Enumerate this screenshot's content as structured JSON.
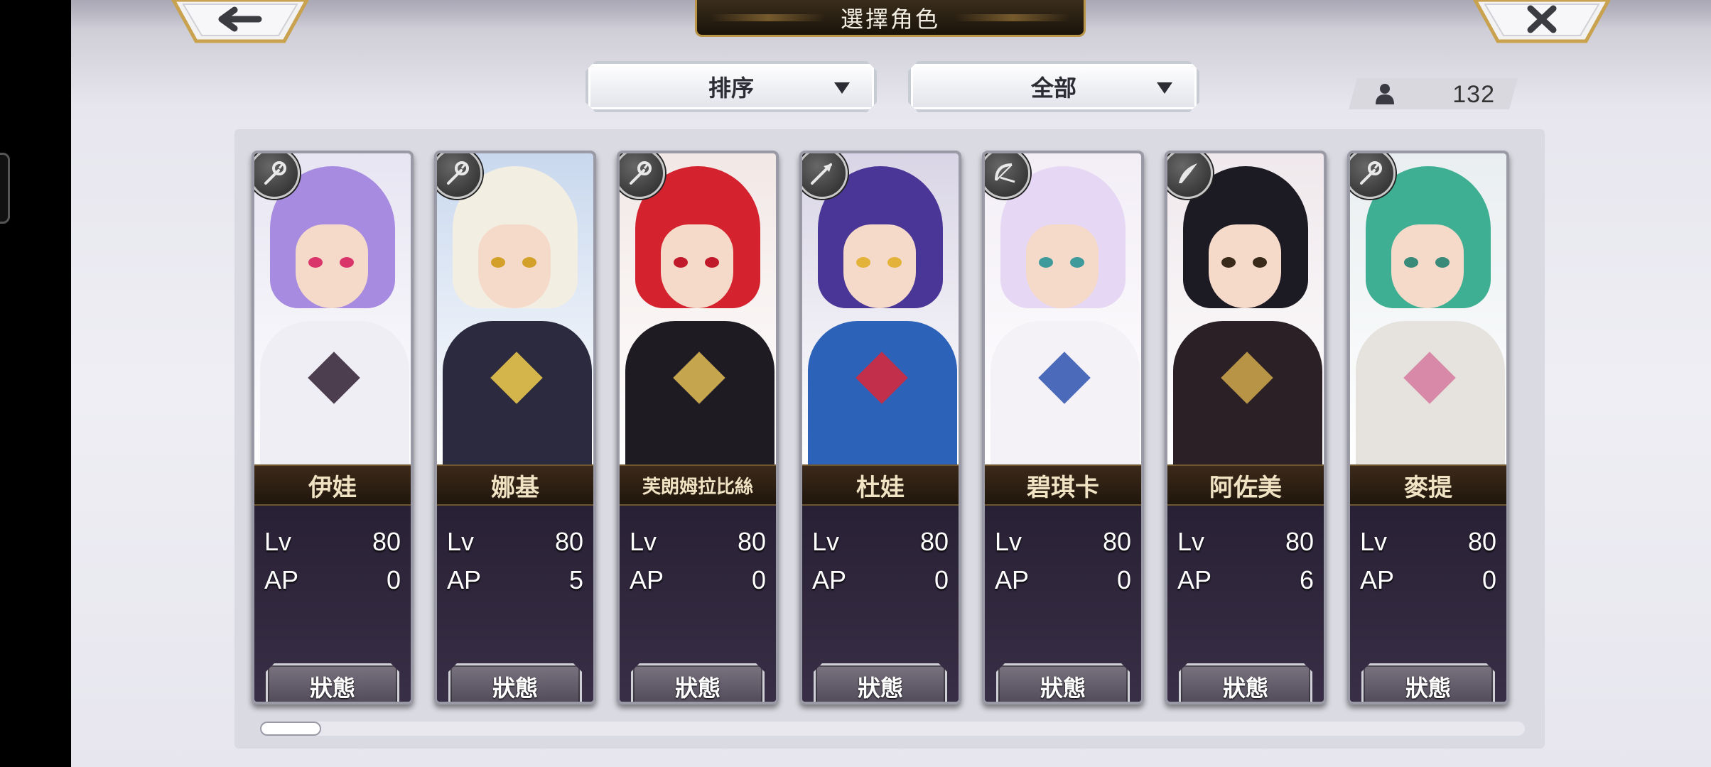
{
  "header": {
    "title": "選擇角色",
    "back_icon": "back-arrow-icon",
    "close_icon": "close-icon"
  },
  "filters": {
    "sort_label": "排序",
    "filter_label": "全部"
  },
  "unit_count": "132",
  "characters": [
    {
      "name": "伊娃",
      "lv_label": "Lv",
      "lv": "80",
      "ap_label": "AP",
      "ap": "0",
      "status_label": "狀態",
      "weapon": "staff-icon",
      "hair": "#a78be0",
      "bg": "#e7e5f2",
      "eye": "#d9356a",
      "body": "#efeef4",
      "accent": "#3a2a3d"
    },
    {
      "name": "娜基",
      "lv_label": "Lv",
      "lv": "80",
      "ap_label": "AP",
      "ap": "5",
      "status_label": "狀態",
      "weapon": "staff-icon",
      "hair": "#f3eee2",
      "bg": "#c9d8ee",
      "eye": "#d3a02a",
      "body": "#2b2a3e",
      "accent": "#e7c44c"
    },
    {
      "name": "芙朗姆拉比絲",
      "lv_label": "Lv",
      "lv": "80",
      "ap_label": "AP",
      "ap": "0",
      "status_label": "狀態",
      "weapon": "staff-icon",
      "hair": "#d4222f",
      "bg": "#f2e8e6",
      "eye": "#c0192a",
      "body": "#1e1c22",
      "accent": "#d8b554"
    },
    {
      "name": "杜娃",
      "lv_label": "Lv",
      "lv": "80",
      "ap_label": "AP",
      "ap": "0",
      "status_label": "狀態",
      "weapon": "spear-icon",
      "hair": "#4a3696",
      "bg": "#d9d5e6",
      "eye": "#e3b23a",
      "body": "#2c62b8",
      "accent": "#d22a3f"
    },
    {
      "name": "碧琪卡",
      "lv_label": "Lv",
      "lv": "80",
      "ap_label": "AP",
      "ap": "0",
      "status_label": "狀態",
      "weapon": "bow-icon",
      "hair": "#e6d8f4",
      "bg": "#f3eef6",
      "eye": "#3f9a9c",
      "body": "#f4f2f6",
      "accent": "#3a5bb4"
    },
    {
      "name": "阿佐美",
      "lv_label": "Lv",
      "lv": "80",
      "ap_label": "AP",
      "ap": "6",
      "status_label": "狀態",
      "weapon": "blade-icon",
      "hair": "#1c1a22",
      "bg": "#efe8ec",
      "eye": "#3a2a1a",
      "body": "#2a2026",
      "accent": "#c6a14a"
    },
    {
      "name": "麥提",
      "lv_label": "Lv",
      "lv": "80",
      "ap_label": "AP",
      "ap": "0",
      "status_label": "狀態",
      "weapon": "staff-icon",
      "hair": "#3faf94",
      "bg": "#e9eef0",
      "eye": "#3a8a7a",
      "body": "#e6e2de",
      "accent": "#d67fa1"
    }
  ],
  "scroll": {
    "position": 0
  },
  "colors": {
    "title_bg": "#2a1f12",
    "gold_border": "#b99548",
    "name_text": "#efe3c3"
  }
}
